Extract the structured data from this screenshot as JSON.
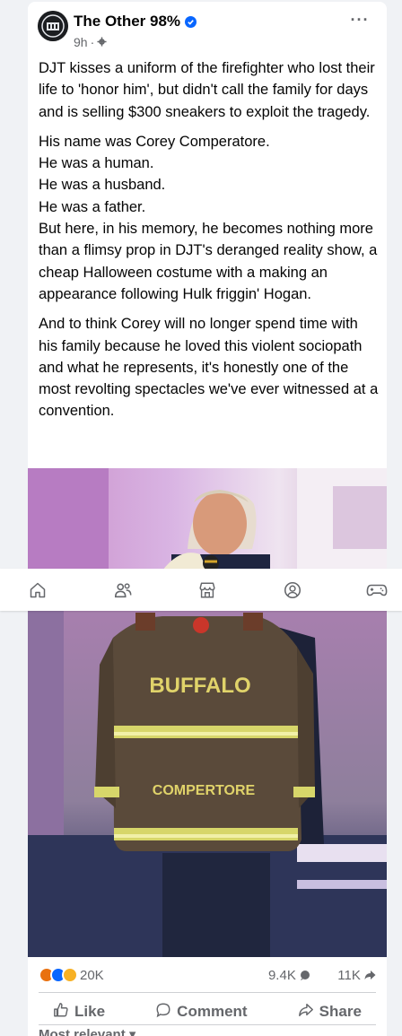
{
  "post": {
    "page_name": "The Other 98%",
    "time": "9h",
    "paragraphs": [
      "DJT kisses a uniform of the firefighter who lost their life to 'honor him', but didn't call the family for days and is selling $300 sneakers to exploit the tragedy."
    ],
    "lines": [
      "His name was Corey Comperatore.",
      "He was a human.",
      "He was a husband.",
      "He was a father.",
      "But here, in his memory, he becomes nothing more than a flimsy prop in DJT's deranged reality show, a cheap Halloween costume with a making an appearance following Hulk friggin' Hogan."
    ],
    "closing": "And to think Corey will no longer spend time with his family because he loved this violent sociopath and what he represents, it's honestly one of the most revolting spectacles we've ever witnessed at a convention."
  },
  "photo": {
    "jacket_top_text": "BUFFALO",
    "jacket_name_text": "COMPERTORE"
  },
  "stats": {
    "reactions": "20K",
    "comments": "9.4K",
    "shares": "11K"
  },
  "actions": {
    "like": "Like",
    "comment": "Comment",
    "share": "Share"
  },
  "sort_label": "Most relevant",
  "nav": [
    "home-icon",
    "friends-icon",
    "marketplace-icon",
    "profile-icon",
    "gaming-icon"
  ],
  "colors": {
    "accent": "#0866ff",
    "angry": "#e9710f",
    "like": "#0866ff",
    "sad": "#f7b125"
  }
}
